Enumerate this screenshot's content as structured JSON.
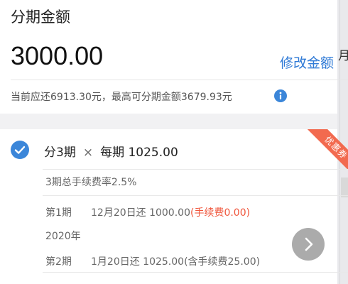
{
  "header": {
    "title": "分期金额",
    "amount": "3000.00",
    "modify_label": "修改金额",
    "hint": "当前应还6913.30元，最高可分期金额3679.93元"
  },
  "plan": {
    "term_label": "分3期",
    "separator": "×",
    "per_period_label": "每期 1025.00",
    "badge": "优惠券",
    "fee_rate": "3期总手续费率2.5%",
    "schedule": [
      {
        "period": "第1期",
        "detail": "12月20日还 1000.00",
        "fee": "(手续费0.00)"
      },
      {
        "period": "第2期",
        "detail": "1月20日还 1025.00(含手续费25.00)"
      }
    ],
    "year_label": "2020年"
  },
  "side": {
    "char": "月"
  },
  "colors": {
    "accent": "#3b86d9",
    "link": "#2f7ad6",
    "badge": "#f26a4f",
    "fee_highlight": "#f0563c"
  },
  "icons": {
    "info": "info-icon",
    "check": "check-icon",
    "fab": "chevron-right-icon"
  }
}
